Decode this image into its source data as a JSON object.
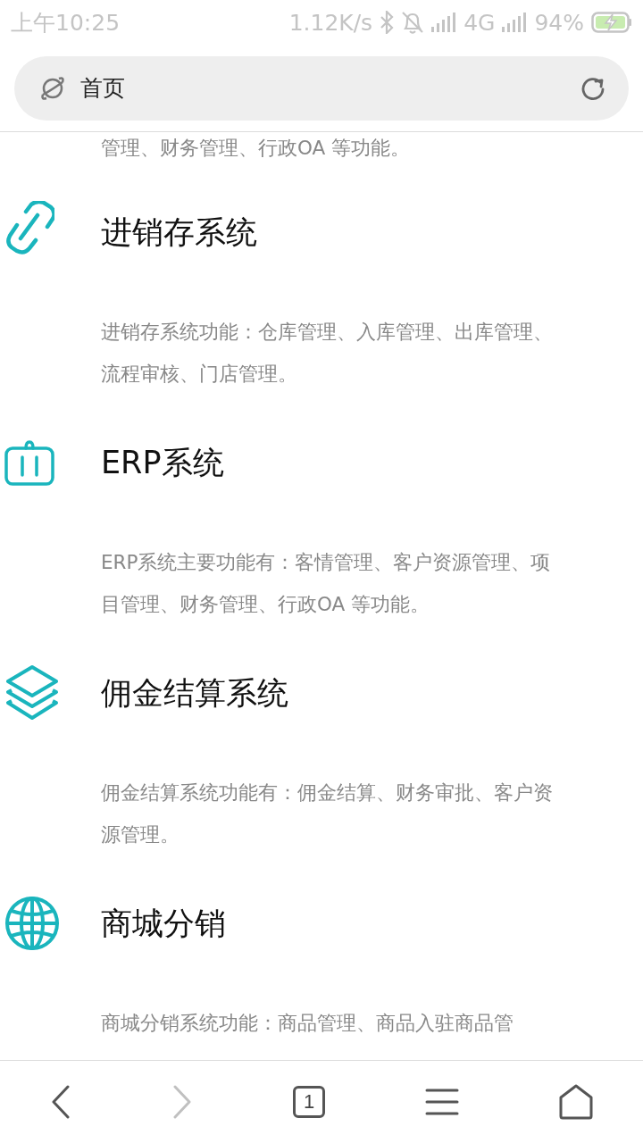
{
  "status_bar": {
    "time": "上午10:25",
    "speed": "1.12K/s",
    "network": "4G",
    "battery": "94%"
  },
  "address_bar": {
    "value": "首页"
  },
  "content": {
    "top_text": "管理、财务管理、行政OA 等功能。",
    "sections": [
      {
        "kind": "link",
        "title": "进销存系统",
        "description": "进销存系统功能：仓库管理、入库管理、出库管理、流程审核、门店管理。"
      },
      {
        "kind": "case",
        "title": "ERP系统",
        "description": "ERP系统主要功能有：客情管理、客户资源管理、项目管理、财务管理、行政OA 等功能。"
      },
      {
        "kind": "layers",
        "title": "佣金结算系统",
        "description": "佣金结算系统功能有：佣金结算、财务审批、客户资源管理。"
      },
      {
        "kind": "globe",
        "title": "商城分销",
        "description": "商城分销系统功能：商品管理、商品入驻商品管"
      }
    ]
  },
  "nav": [
    {
      "kind": "back",
      "disabled": false
    },
    {
      "kind": "forward",
      "disabled": true
    },
    {
      "kind": "tabs",
      "label": "1"
    },
    {
      "kind": "menu"
    },
    {
      "kind": "home"
    }
  ]
}
